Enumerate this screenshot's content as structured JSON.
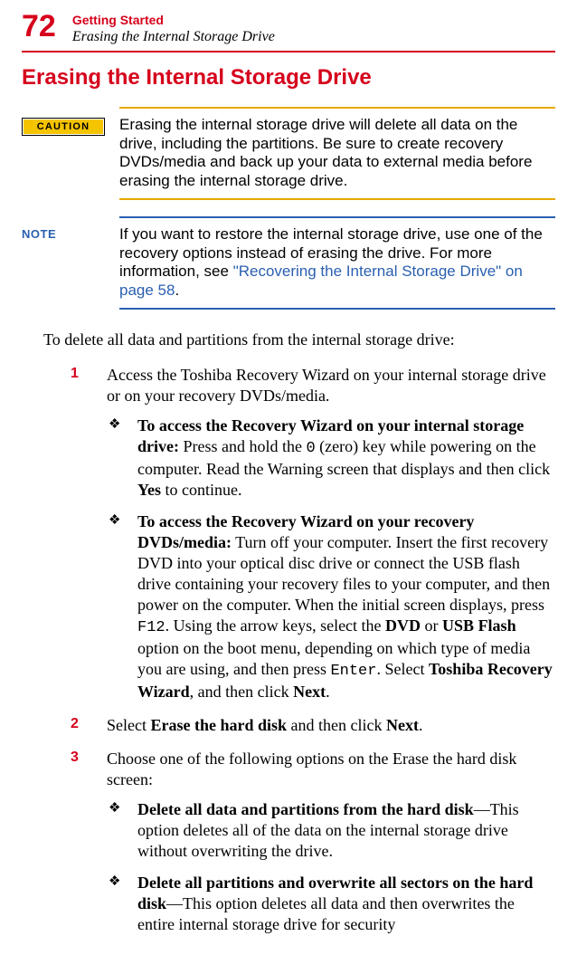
{
  "header": {
    "page_number": "72",
    "chapter": "Getting Started",
    "section_title": "Erasing the Internal Storage Drive"
  },
  "heading": "Erasing the Internal Storage Drive",
  "caution": {
    "label": "CAUTION",
    "text": "Erasing the internal storage drive will delete all data on the drive, including the partitions. Be sure to create recovery DVDs/media and back up your data to external media before erasing the internal storage drive."
  },
  "note": {
    "label": "NOTE",
    "text_pre": "If you want to restore the internal storage drive, use one of the recovery options instead of erasing the drive. For more information, see ",
    "link_text": "\"Recovering the Internal Storage Drive\" on page 58",
    "text_post": "."
  },
  "intro": "To delete all data and partitions from the internal storage drive:",
  "steps": {
    "s1": {
      "num": "1",
      "text": "Access the Toshiba Recovery Wizard on your internal storage drive or on your recovery DVDs/media.",
      "b1": {
        "lead": "To access the Recovery Wizard on your internal storage drive:",
        "a": " Press and hold the ",
        "key0": "0",
        "b": " (zero) key while powering on the computer. Read the Warning screen that displays and then click ",
        "yes": "Yes",
        "c": " to continue."
      },
      "b2": {
        "lead": "To access the Recovery Wizard on your recovery DVDs/media:",
        "a": " Turn off your computer. Insert the first recovery DVD into your optical disc drive or connect the USB flash drive containing your recovery files to your computer, and then power on the computer. When the initial screen displays, press ",
        "f12": "F12",
        "b": ". Using the arrow keys, select the ",
        "dvd": "DVD",
        "or": " or ",
        "usb": "USB Flash",
        "c": " option on the boot menu, depending on which type of media you are using, and then press ",
        "enter": "Enter",
        "d": ". Select ",
        "trw": "Toshiba Recovery Wizard",
        "e": ", and then click ",
        "next": "Next",
        "f": "."
      }
    },
    "s2": {
      "num": "2",
      "a": "Select ",
      "erase": "Erase the hard disk",
      "b": " and then click ",
      "next": "Next",
      "c": "."
    },
    "s3": {
      "num": "3",
      "text": "Choose one of the following options on the Erase the hard disk screen:",
      "b1": {
        "lead": "Delete all data and partitions from the hard disk",
        "rest": "—This option deletes all of the data on the internal storage drive without overwriting the drive."
      },
      "b2": {
        "lead": "Delete all partitions and overwrite all sectors on the hard disk",
        "rest": "—This option deletes all data and then overwrites the entire internal storage drive for security"
      }
    }
  }
}
